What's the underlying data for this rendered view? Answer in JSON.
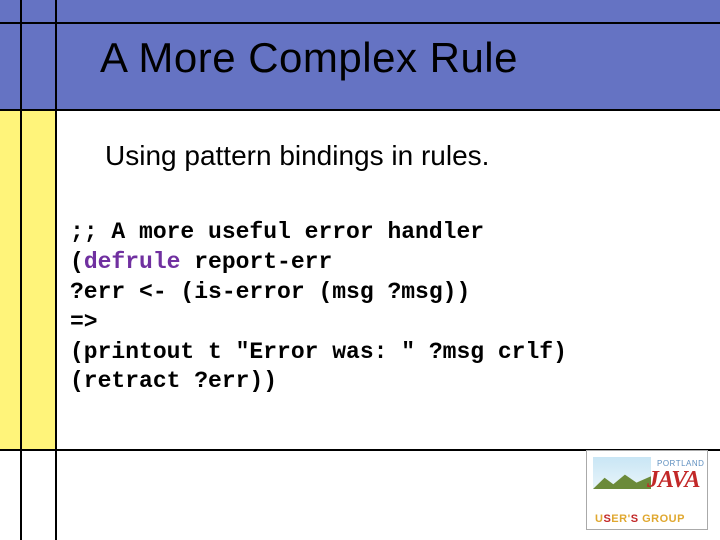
{
  "title": "A More Complex Rule",
  "subtitle": "Using pattern bindings in rules.",
  "code": {
    "l1": ";; A more useful error handler",
    "l2a": "(",
    "l2b": "defrule",
    "l2c": " report-err",
    "l3": "?err <- (is-error (msg ?msg))",
    "l4": "=>",
    "l5": "(printout t \"Error was: \" ?msg crlf)",
    "l6": "(retract ?err))"
  },
  "logo": {
    "top": "PORTLAND",
    "main": "JAVA",
    "u": "U",
    "s": "S",
    "er": "ER'",
    "s2": "S ",
    "group": "GROUP"
  }
}
